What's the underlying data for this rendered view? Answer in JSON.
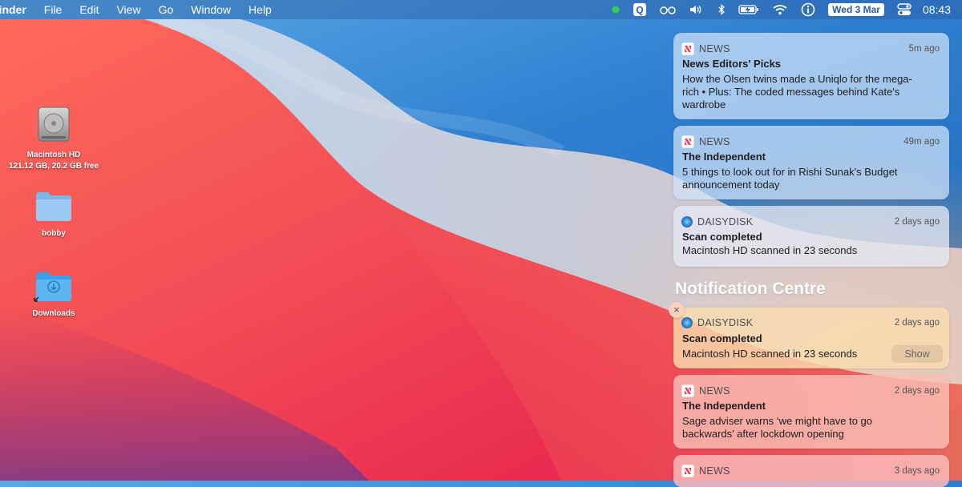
{
  "menubar": {
    "app_name": "Finder",
    "items": [
      "File",
      "Edit",
      "View",
      "Go",
      "Window",
      "Help"
    ],
    "status_icons": [
      "green-dot-icon",
      "q-app-icon",
      "glasses-icon",
      "volume-icon",
      "bluetooth-icon",
      "battery-charging-icon",
      "wifi-icon",
      "info-circle-icon"
    ],
    "date": "Wed 3 Mar",
    "control_center_icon": "control-center-icon",
    "time": "08:43"
  },
  "desktop": {
    "icons": [
      {
        "label": "Macintosh HD",
        "sublabel": "121.12 GB, 20.2 GB free",
        "icon": "hard-drive-icon"
      },
      {
        "label": "bobby",
        "icon": "folder-icon"
      },
      {
        "label": "Downloads",
        "icon": "downloads-folder-icon"
      }
    ]
  },
  "notification_centre": {
    "title": "Notification Centre",
    "pinned": [
      {
        "app": "NEWS",
        "icon": "news-icon",
        "time": "5m ago",
        "title": "News Editors' Picks",
        "body": "How the Olsen twins made a Uniqlo for the mega-rich • Plus: The coded messages behind Kate's wardrobe"
      },
      {
        "app": "NEWS",
        "icon": "news-icon",
        "time": "49m ago",
        "title": "The Independent",
        "body": "5 things to look out for in Rishi Sunak's Budget announcement today"
      },
      {
        "app": "DAISYDISK",
        "icon": "daisydisk-icon",
        "time": "2 days ago",
        "title": "Scan completed",
        "body": "Macintosh HD scanned in 23 seconds"
      }
    ],
    "list": [
      {
        "app": "DAISYDISK",
        "icon": "daisydisk-icon",
        "time": "2 days ago",
        "title": "Scan completed",
        "body": "Macintosh HD scanned in 23 seconds",
        "action": "Show"
      },
      {
        "app": "NEWS",
        "icon": "news-icon",
        "time": "2 days ago",
        "title": "The Independent",
        "body": "Sage adviser warns ‘we might have to go backwards’ after lockdown opening"
      },
      {
        "app": "NEWS",
        "icon": "news-icon",
        "time": "3 days ago"
      }
    ],
    "close_label": "×"
  }
}
